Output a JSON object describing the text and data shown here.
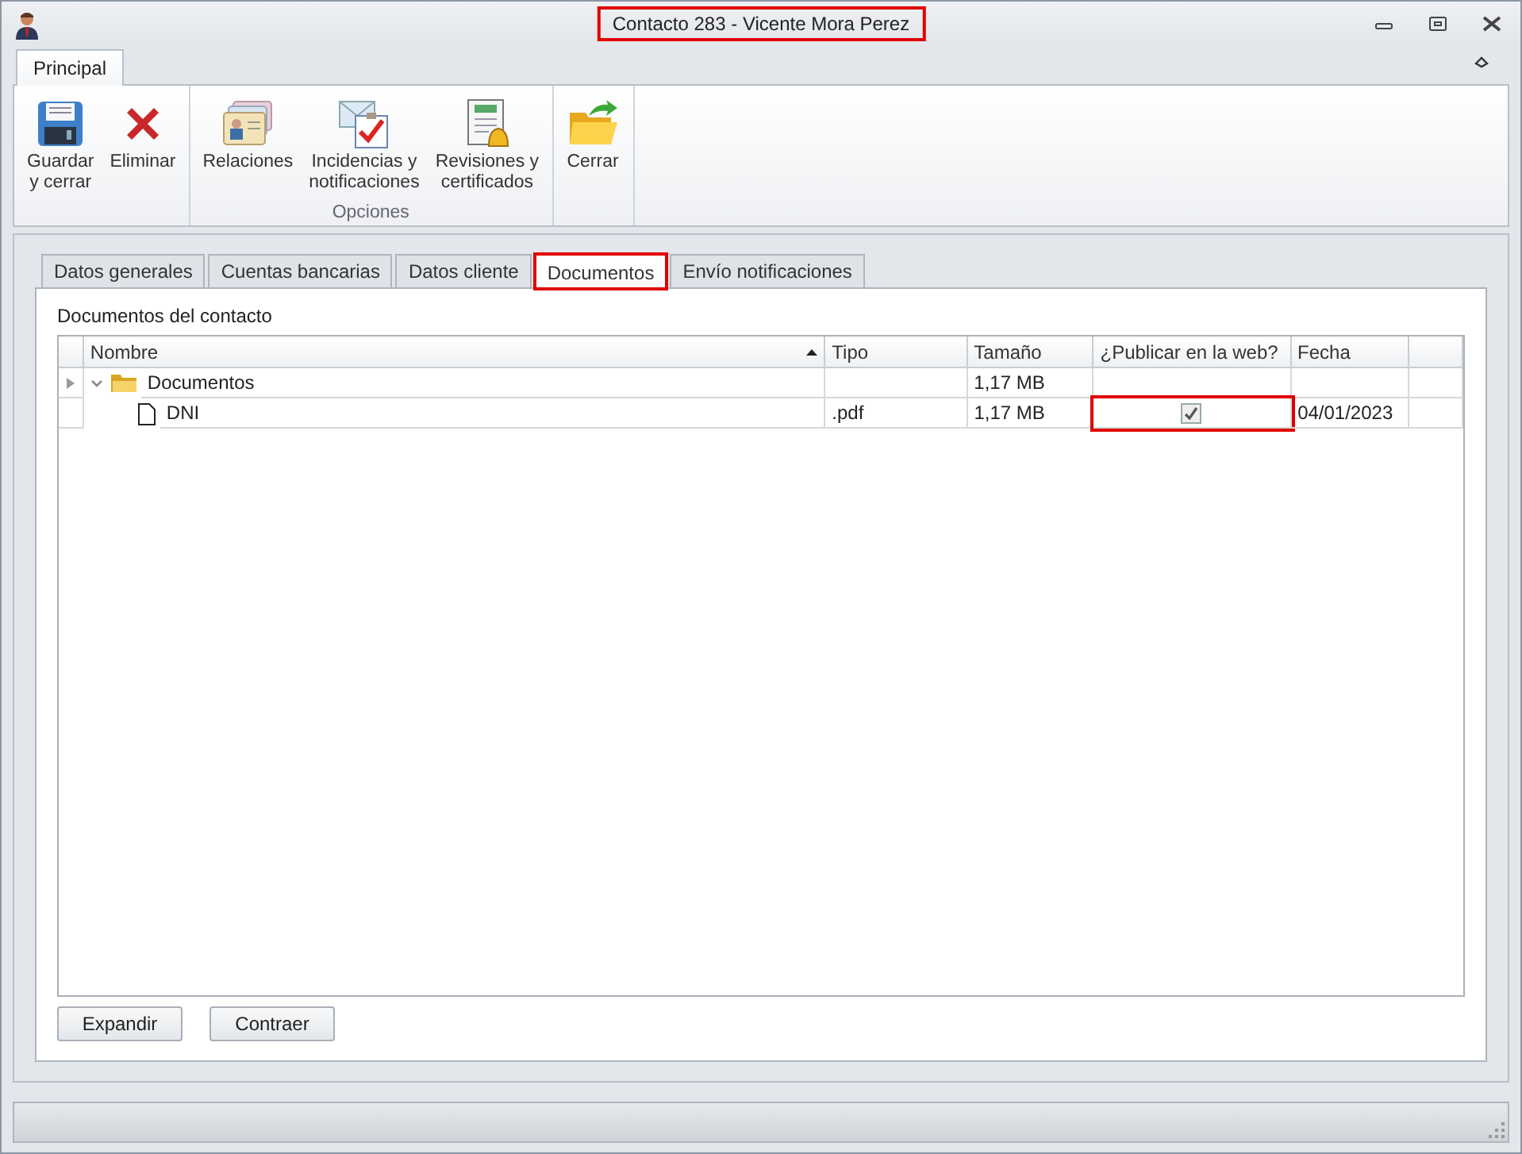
{
  "window": {
    "title": "Contacto 283 - Vicente Mora Perez",
    "title_highlighted": true
  },
  "ribbon": {
    "tabs": [
      {
        "label": "Principal",
        "selected": true
      }
    ],
    "groups": [
      {
        "buttons": [
          {
            "label": "Guardar\ny cerrar",
            "kind": "save"
          },
          {
            "label": "Eliminar",
            "kind": "delete"
          }
        ]
      },
      {
        "label": "Opciones",
        "buttons": [
          {
            "label": "Relaciones",
            "kind": "cards"
          },
          {
            "label": "Incidencias y\nnotificaciones",
            "kind": "mail"
          },
          {
            "label": "Revisiones y\ncertificados",
            "kind": "bell"
          }
        ]
      },
      {
        "buttons": [
          {
            "label": "Cerrar",
            "kind": "folder"
          }
        ]
      }
    ]
  },
  "tabs": [
    {
      "label": "Datos generales",
      "selected": false,
      "highlighted": false
    },
    {
      "label": "Cuentas bancarias",
      "selected": false,
      "highlighted": false
    },
    {
      "label": "Datos cliente",
      "selected": false,
      "highlighted": false
    },
    {
      "label": "Documentos",
      "selected": true,
      "highlighted": true
    },
    {
      "label": "Envío notificaciones",
      "selected": false,
      "highlighted": false
    }
  ],
  "section_title": "Documentos del contacto",
  "table": {
    "columns": [
      {
        "label": "Nombre",
        "sorted": true
      },
      {
        "label": "Tipo",
        "sorted": false
      },
      {
        "label": "Tamaño",
        "sorted": false
      },
      {
        "label": "¿Publicar en la web?",
        "sorted": false
      },
      {
        "label": "Fecha",
        "sorted": false
      }
    ],
    "rows": [
      {
        "name": "Documentos",
        "kind": "folder",
        "expanded": true,
        "current": true,
        "type": "",
        "size": "1,17 MB",
        "publish": null,
        "publish_highlighted": false,
        "date": "",
        "children": [
          {
            "name": "DNI",
            "kind": "file",
            "current": false,
            "type": ".pdf",
            "size": "1,17 MB",
            "publish": true,
            "publish_highlighted": true,
            "date": "04/01/2023"
          }
        ]
      }
    ]
  },
  "buttons": [
    "Expandir",
    "Contraer"
  ]
}
